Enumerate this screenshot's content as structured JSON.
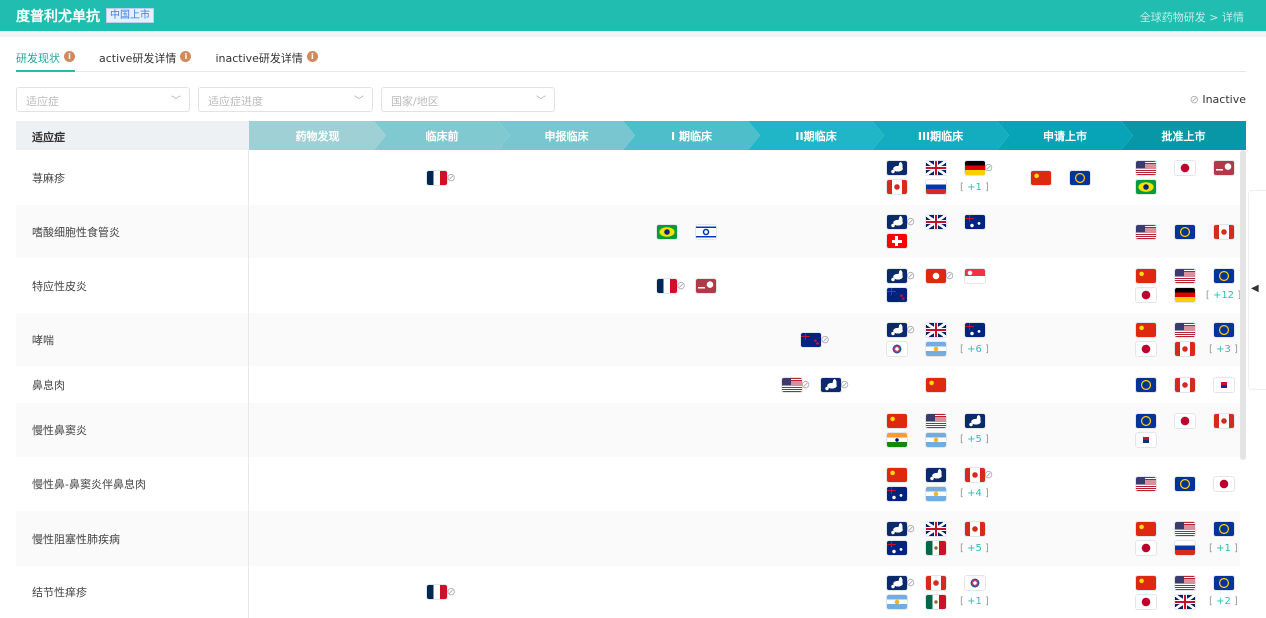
{
  "header": {
    "title": "度普利尤单抗",
    "badge": "中国上市",
    "breadcrumb": "全球药物研发 > 详情"
  },
  "tabs": [
    {
      "label": "研发现状",
      "active": true
    },
    {
      "label": "active研发详情"
    },
    {
      "label": "inactive研发详情"
    }
  ],
  "filters": [
    {
      "placeholder": "适应症"
    },
    {
      "placeholder": "适应症进度"
    },
    {
      "placeholder": "国家/地区"
    }
  ],
  "legend": {
    "icon": "⊘",
    "label": "Inactive"
  },
  "table": {
    "indication_header": "适应症",
    "stages": [
      "药物发现",
      "临床前",
      "申报临床",
      "I 期临床",
      "II期临床",
      "III期临床",
      "申请上市",
      "批准上市"
    ],
    "stage_colors": [
      "#9fd0d6",
      "#80c9d1",
      "#79c6d0",
      "#4ebecb",
      "#20b6c7",
      "#14adc0",
      "#07a4b7",
      "#0897a6"
    ],
    "rows": [
      {
        "indication": "荨麻疹",
        "cells": {
          "1": {
            "flags": [
              [
                "fr",
                1
              ]
            ]
          },
          "5": {
            "flags": [
              [
                "eumap",
                0
              ],
              [
                "gb",
                0
              ],
              [
                "de",
                1
              ],
              [
                "ca",
                0
              ],
              [
                "ru",
                0
              ]
            ],
            "more": "+1"
          },
          "6": {
            "flags": [
              [
                "cn",
                0
              ],
              [
                "eu",
                0
              ]
            ]
          },
          "7": {
            "flags": [
              [
                "us",
                0
              ],
              [
                "jp",
                0
              ],
              [
                "xx",
                0
              ],
              [
                "br",
                0
              ]
            ]
          }
        }
      },
      {
        "indication": "嗜酸细胞性食管炎",
        "cells": {
          "3": {
            "flags": [
              [
                "br",
                0
              ],
              [
                "il",
                0
              ]
            ]
          },
          "5": {
            "flags": [
              [
                "eumap",
                1
              ],
              [
                "gb",
                0
              ],
              [
                "au",
                0
              ],
              [
                "ch",
                0
              ]
            ]
          },
          "7": {
            "flags": [
              [
                "us",
                0
              ],
              [
                "eu",
                0
              ],
              [
                "ca",
                0
              ]
            ]
          }
        }
      },
      {
        "indication": "特应性皮炎",
        "cells": {
          "3": {
            "flags": [
              [
                "fr",
                1
              ],
              [
                "xx",
                0
              ]
            ]
          },
          "5": {
            "flags": [
              [
                "eumap",
                1
              ],
              [
                "hk",
                1
              ],
              [
                "sg",
                0
              ],
              [
                "nz",
                0
              ]
            ]
          },
          "7": {
            "flags": [
              [
                "cn",
                0
              ],
              [
                "us",
                0
              ],
              [
                "eu",
                0
              ],
              [
                "jp",
                0
              ],
              [
                "de",
                0
              ]
            ],
            "more": "+12"
          }
        }
      },
      {
        "indication": "哮喘",
        "cells": {
          "4": {
            "flags": [
              [
                "nz",
                1
              ]
            ]
          },
          "5": {
            "flags": [
              [
                "eumap",
                1
              ],
              [
                "gb",
                0
              ],
              [
                "au",
                0
              ],
              [
                "tw",
                0
              ],
              [
                "ar",
                0
              ]
            ],
            "more": "+6"
          },
          "7": {
            "flags": [
              [
                "cn",
                0
              ],
              [
                "us",
                0
              ],
              [
                "eu",
                0
              ],
              [
                "jp",
                0
              ],
              [
                "ca",
                0
              ]
            ],
            "more": "+3"
          }
        }
      },
      {
        "indication": "鼻息肉",
        "cells": {
          "4": {
            "flags": [
              [
                "us",
                1
              ],
              [
                "eumap",
                1
              ]
            ]
          },
          "5": {
            "flags": [
              [
                "cn",
                0
              ]
            ]
          },
          "7": {
            "flags": [
              [
                "eu",
                0
              ],
              [
                "ca",
                0
              ],
              [
                "kr",
                0
              ]
            ]
          }
        }
      },
      {
        "indication": "慢性鼻窦炎",
        "cells": {
          "5": {
            "flags": [
              [
                "cn",
                0
              ],
              [
                "us",
                0
              ],
              [
                "eumap",
                0
              ],
              [
                "in",
                0
              ],
              [
                "ar",
                0
              ]
            ],
            "more": "+5"
          },
          "7": {
            "flags": [
              [
                "eu",
                0
              ],
              [
                "jp",
                0
              ],
              [
                "ca",
                0
              ],
              [
                "kr",
                0
              ]
            ]
          }
        }
      },
      {
        "indication": "慢性鼻-鼻窦炎伴鼻息肉",
        "cells": {
          "5": {
            "flags": [
              [
                "cn",
                0
              ],
              [
                "eumap",
                0
              ],
              [
                "ca",
                1
              ],
              [
                "au",
                0
              ],
              [
                "ar",
                0
              ]
            ],
            "more": "+4"
          },
          "7": {
            "flags": [
              [
                "us",
                0
              ],
              [
                "eu",
                0
              ],
              [
                "jp",
                0
              ]
            ]
          }
        }
      },
      {
        "indication": "慢性阻塞性肺疾病",
        "cells": {
          "5": {
            "flags": [
              [
                "eumap",
                1
              ],
              [
                "gb",
                0
              ],
              [
                "ca",
                0
              ],
              [
                "au",
                0
              ],
              [
                "mx",
                0
              ]
            ],
            "more": "+5"
          },
          "7": {
            "flags": [
              [
                "cn",
                0
              ],
              [
                "us",
                0
              ],
              [
                "eu",
                0
              ],
              [
                "jp",
                0
              ],
              [
                "ru",
                0
              ]
            ],
            "more": "+1"
          }
        }
      },
      {
        "indication": "结节性痒疹",
        "cells": {
          "1": {
            "flags": [
              [
                "fr",
                1
              ]
            ]
          },
          "5": {
            "flags": [
              [
                "eumap",
                1
              ],
              [
                "ca",
                0
              ],
              [
                "tw",
                0
              ],
              [
                "ar",
                0
              ],
              [
                "mx",
                0
              ]
            ],
            "more": "+1"
          },
          "7": {
            "flags": [
              [
                "cn",
                0
              ],
              [
                "us",
                0
              ],
              [
                "eu",
                0
              ],
              [
                "jp",
                0
              ],
              [
                "gb",
                0
              ]
            ],
            "more": "+2"
          }
        }
      }
    ]
  }
}
